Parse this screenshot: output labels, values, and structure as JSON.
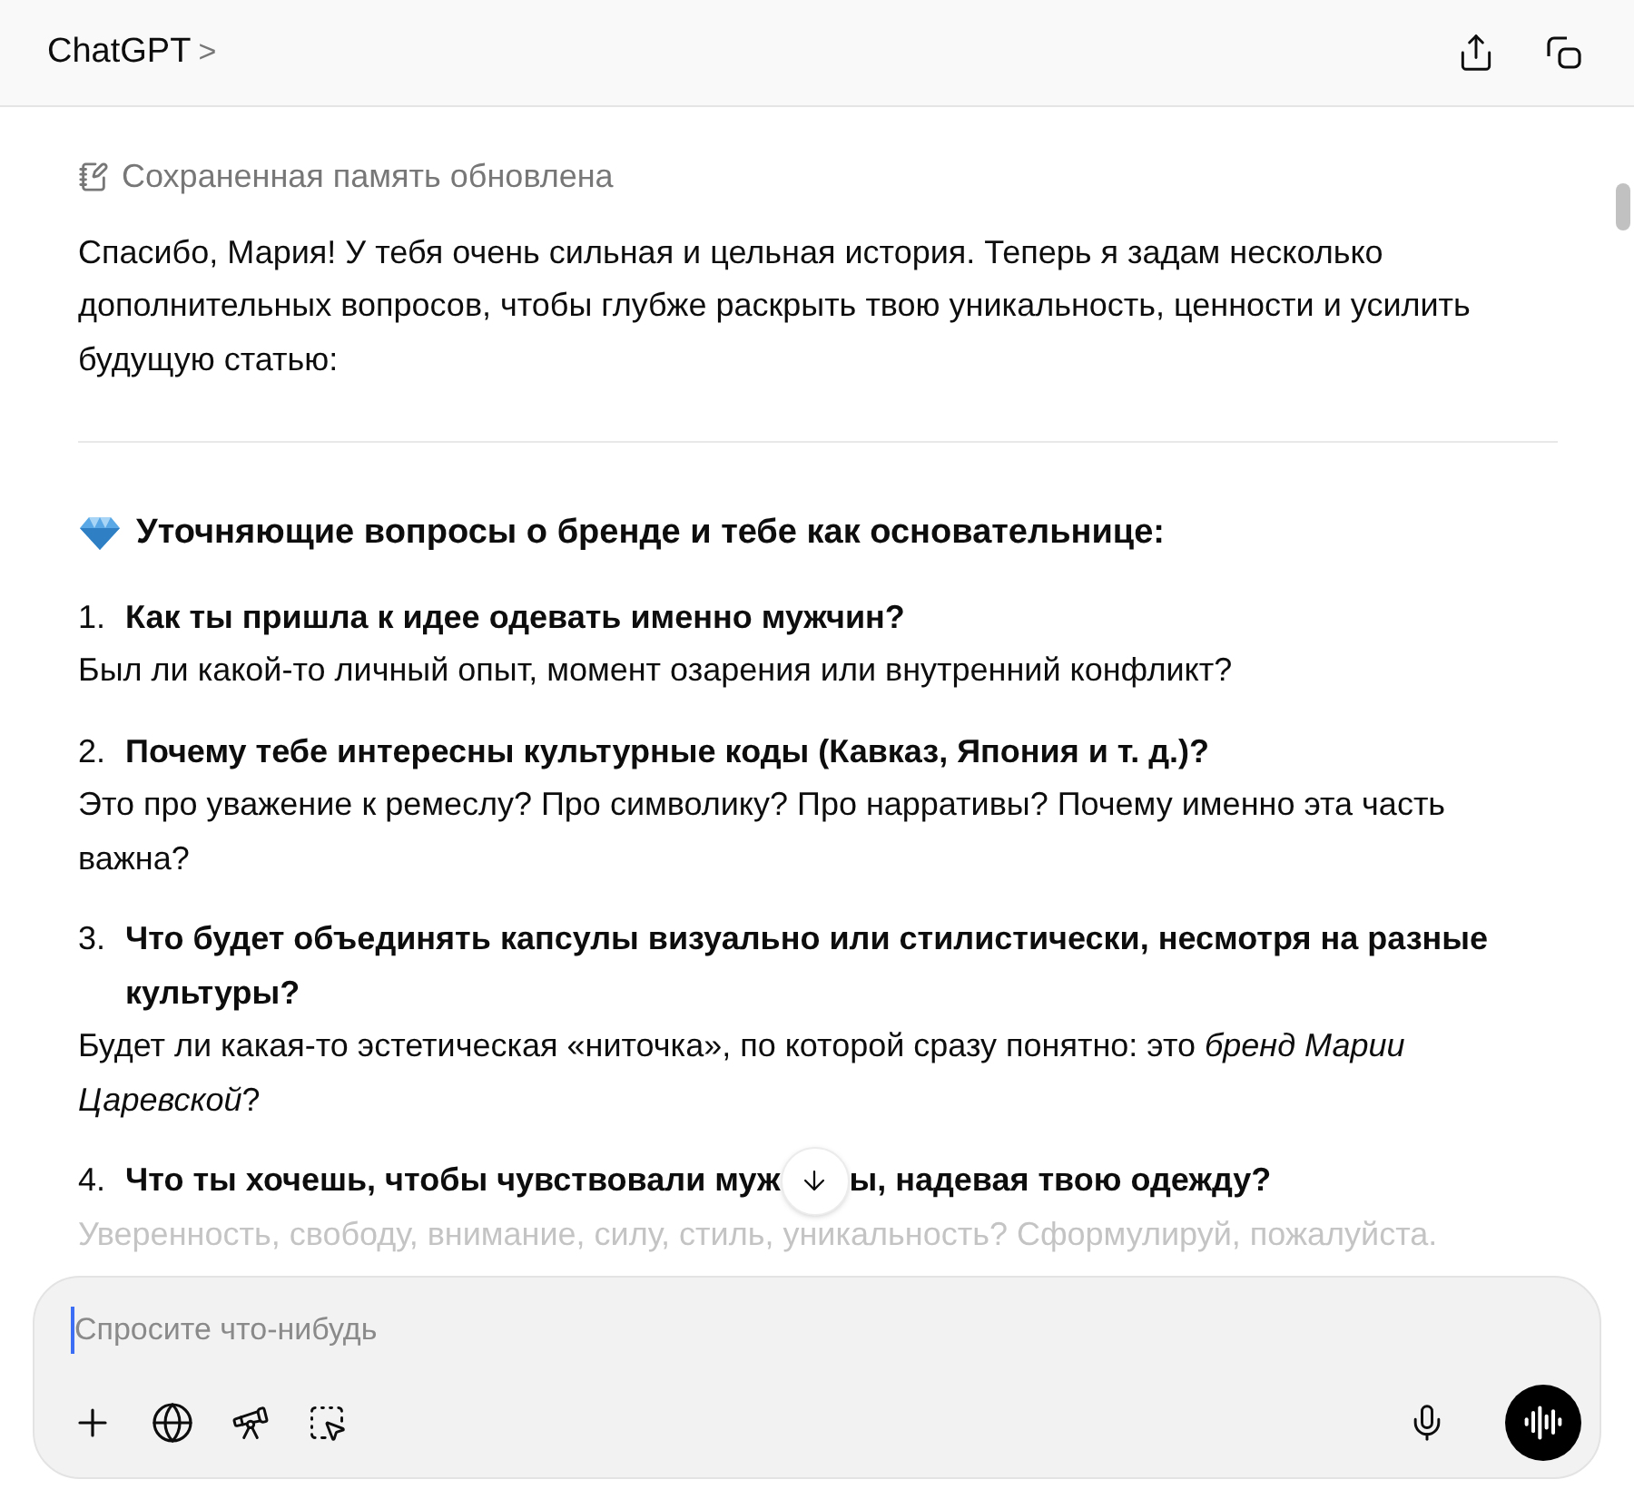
{
  "header": {
    "title": "ChatGPT",
    "chevron": ">"
  },
  "memory_notice": "Сохраненная память обновлена",
  "intro": "Спасибо, Мария! У тебя очень сильная и цельная история. Теперь я задам несколько дополнительных вопросов, чтобы глубже раскрыть твою уникальность, ценности и усилить будущую статью:",
  "section_heading": "Уточняющие вопросы о бренде и тебе как основательнице:",
  "questions": [
    {
      "number": "1.",
      "question": "Как ты пришла к идее одевать именно мужчин?",
      "answer": "Был ли какой-то личный опыт, момент озарения или внутренний конфликт?",
      "faded": false
    },
    {
      "number": "2.",
      "question": "Почему тебе интересны культурные коды (Кавказ, Япония и т. д.)?",
      "answer": "Это про уважение к ремеслу? Про символику? Про нарративы? Почему именно эта часть важна?",
      "faded": false
    },
    {
      "number": "3.",
      "question": "Что будет объединять капсулы визуально или стилистически, несмотря на разные культуры?",
      "answer": "Будет ли какая-то эстетическая «ниточка», по которой сразу понятно: это *бренд Марии Царевской*?",
      "faded": false
    },
    {
      "number": "4.",
      "question_parts": [
        "Что ты хочешь, чтобы чувствовали муж",
        "ы, надевая твою одежду?"
      ],
      "answer": "Уверенность, свободу, внимание, силу, стиль, уникальность? Сформулируй, пожалуйста.",
      "faded": true
    }
  ],
  "composer": {
    "placeholder": "Спросите что-нибудь"
  }
}
